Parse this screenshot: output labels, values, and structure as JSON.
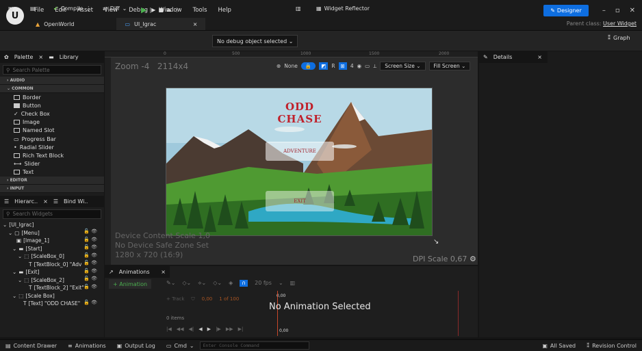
{
  "titlebar": {
    "menu": [
      "File",
      "Edit",
      "Asset",
      "View",
      "Debug",
      "Window",
      "Tools",
      "Help"
    ],
    "project": "OpenWorld",
    "tab": "UI_Igrac",
    "parent_class_label": "Parent class:",
    "parent_class_value": "User Widget"
  },
  "toolbar": {
    "compile": "Compile",
    "diff": "Diff",
    "debug_object": "No debug object selected",
    "widget_reflector": "Widget Reflector",
    "designer": "Designer",
    "graph": "Graph"
  },
  "palette": {
    "tab_palette": "Palette",
    "tab_library": "Library",
    "search_placeholder": "Search Palette",
    "cat_audio": "AUDIO",
    "cat_common": "COMMON",
    "cat_editor": "EDITOR",
    "cat_input": "INPUT",
    "items": [
      "Border",
      "Button",
      "Check Box",
      "Image",
      "Named Slot",
      "Progress Bar",
      "Radial Slider",
      "Rich Text Block",
      "Slider",
      "Text"
    ]
  },
  "hierarchy": {
    "tab_hierarchy": "Hierarc..",
    "tab_bind": "Bind Wi..",
    "search_placeholder": "Search Widgets",
    "rows": [
      "[UI_Igrac]",
      "[Menu]",
      "[Image_1]",
      "[Start]",
      "[ScaleBox_0]",
      "[TextBlock_0] \"Adv",
      "[Exit]",
      "[ScaleBox_2]",
      "[TextBlock_2] \"Exit\"",
      "[Scale Box]",
      "[Text] \"ODD CHASE\""
    ]
  },
  "canvas": {
    "zoom": "Zoom -4",
    "size": "2114x4",
    "none_btn": "None",
    "r_label": "R",
    "grid_num": "4",
    "screen_size": "Screen Size",
    "fill_screen": "Fill Screen",
    "ruler": [
      "0",
      "500",
      "1000",
      "1500",
      "2000"
    ],
    "device_content_scale": "Device Content Scale 1,0",
    "safe_zone": "No Device Safe Zone Set",
    "resolution": "1280 x 720 (16:9)",
    "dpi_scale": "DPI Scale 0,67"
  },
  "game": {
    "title": "ODD CHASE",
    "btn_adventure": "ADVENTURE",
    "btn_exit": "EXIT"
  },
  "details": {
    "tab": "Details"
  },
  "animations": {
    "tab": "Animations",
    "add_button": "+ Animation",
    "fps": "20 fps",
    "track_button": "+ Track",
    "time_a": "0,00",
    "time_b": "1 of 100",
    "time_marker": "0,00",
    "time_marker2": "0,00",
    "no_anim": "No Animation Selected",
    "items": "0 items"
  },
  "status": {
    "content_drawer": "Content Drawer",
    "animations": "Animations",
    "output_log": "Output Log",
    "cmd": "Cmd",
    "console_placeholder": "Enter Console Command",
    "all_saved": "All Saved",
    "revision": "Revision Control"
  },
  "colors": {
    "accent": "#0e6ee0",
    "title_red": "#c0202a"
  }
}
